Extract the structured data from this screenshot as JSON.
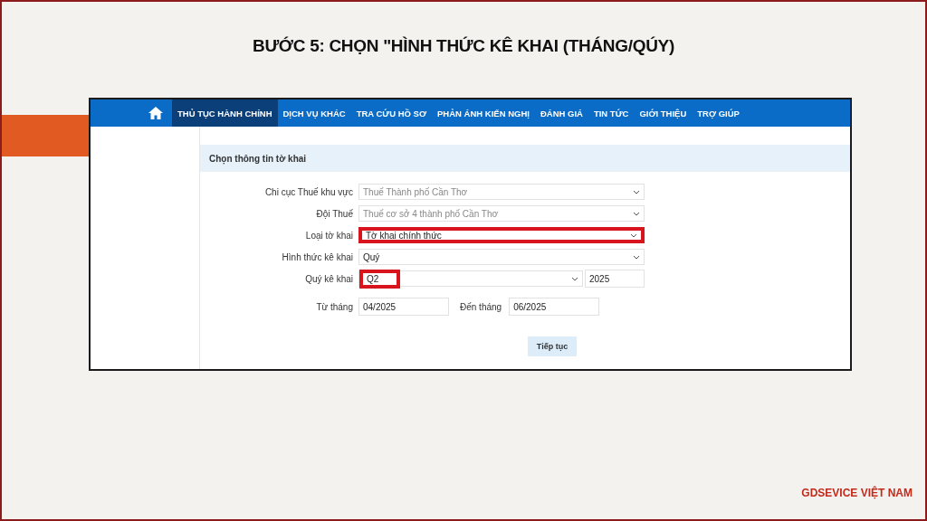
{
  "title": "BƯỚC 5: CHỌN \"HÌNH THỨC KÊ KHAI (THÁNG/QÚY)",
  "nav": {
    "items": [
      {
        "label": "THỦ TỤC HÀNH CHÍNH",
        "selected": true
      },
      {
        "label": "DỊCH VỤ KHÁC",
        "selected": false
      },
      {
        "label": "TRA CỨU HỒ SƠ",
        "selected": false
      },
      {
        "label": "PHẢN ÁNH KIẾN NGHỊ",
        "selected": false
      },
      {
        "label": "ĐÁNH GIÁ",
        "selected": false
      },
      {
        "label": "TIN TỨC",
        "selected": false
      },
      {
        "label": "GIỚI THIỆU",
        "selected": false
      },
      {
        "label": "TRỢ GIÚP",
        "selected": false
      }
    ]
  },
  "form": {
    "heading": "Chọn thông tin tờ khai",
    "rows": [
      {
        "kind": "select",
        "label": "Chi cục Thuế khu vực",
        "value": "Thuế Thành phố Cần Thơ",
        "disabled": true,
        "highlighted": false
      },
      {
        "kind": "select",
        "label": "Đội Thuế",
        "value": "Thuế cơ sở 4 thành phố Cần Thơ",
        "disabled": true,
        "highlighted": false
      },
      {
        "kind": "select",
        "label": "Loại tờ khai",
        "value": "Tờ khai chính thức",
        "disabled": false,
        "highlighted": true
      },
      {
        "kind": "select",
        "label": "Hình thức kê khai",
        "value": "Quý",
        "disabled": false,
        "highlighted": false
      },
      {
        "kind": "quarter",
        "label": "Quý kê khai",
        "value": "Q2",
        "year": "2025",
        "highlighted": true
      },
      {
        "kind": "range",
        "label": "Từ tháng",
        "value": "04/2025",
        "to_label": "Đến tháng",
        "to_value": "06/2025"
      }
    ],
    "button": "Tiếp tục"
  },
  "brand": "GDSEVICE VIỆT NAM"
}
